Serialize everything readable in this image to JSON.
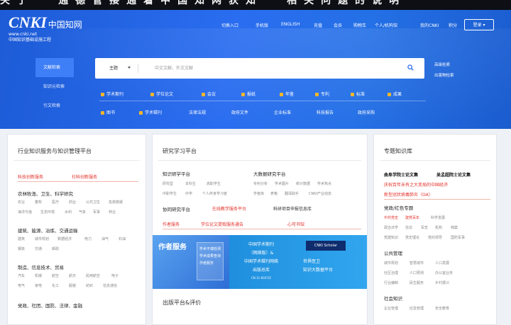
{
  "banner": {
    "text": "关于 “通德管接通着中国知网获知” 相关问题的说明"
  },
  "logo": {
    "mark": "CNKI",
    "mark_cn": "中国知网",
    "url": "www.cnki.net",
    "subtitle": "中国知识基础设施工程"
  },
  "topnav": {
    "items": [
      "切换入口",
      "手机版",
      "ENGLISH",
      "充值",
      "会员",
      "购物车",
      "个人/机构馆",
      "我的CNKI",
      "积分"
    ],
    "login": "登录"
  },
  "search": {
    "tabs": [
      "文献检索",
      "知识元检索",
      "引文检索"
    ],
    "field": "主题",
    "placeholder": "中文文献、外文文献",
    "search_icon": "search-icon",
    "advanced": "高级检索",
    "publication": "出版物检索"
  },
  "databases": {
    "row1": [
      "学术期刊",
      "学位论文",
      "会议",
      "报纸",
      "年鉴",
      "专利",
      "标准",
      "成果"
    ],
    "row2": [
      "图书",
      "学术辑刊",
      "法律法规",
      "政府文件",
      "企业标准",
      "科技报告",
      "政府采购"
    ]
  },
  "industry": {
    "title": "行业知识服务与知识管理平台",
    "top_links": [
      "科技创新服务",
      "社科创新服务"
    ],
    "sections": [
      {
        "heading": "农林牧渔、卫生、科学研究",
        "lines": [
          [
            "农业",
            "畜牧",
            "医疗",
            "药业",
            "公共卫生",
            "急救救援"
          ],
          [
            "海洋与渔",
            "生态环境",
            "水利",
            "气象",
            "军事",
            "林业"
          ]
        ]
      },
      {
        "heading": "建筑、能源、冶炼、交通运输",
        "lines": [
          [
            "建筑",
            "城市规划",
            "数据经济",
            "电力",
            "油气",
            "石油"
          ],
          [
            "钢铁",
            "交通",
            "邮政"
          ]
        ]
      },
      {
        "heading": "制造、信息技术、贸易",
        "lines": [
          [
            "汽车",
            "机械",
            "航空",
            "航天",
            "民用航空",
            "电子"
          ],
          [
            "电气",
            "家电",
            "化工",
            "服装",
            "纺织",
            "信息通信"
          ]
        ]
      },
      {
        "heading": "党政、社团、国防、法律、金融"
      }
    ]
  },
  "research": {
    "title": "研究学习平台",
    "groups": [
      {
        "heading": "知识研学平台",
        "items": [
          [
            "研究型",
            "本科生",
            "高职学生"
          ],
          [
            "中职学生",
            "中学",
            "个人终身学习者"
          ]
        ]
      },
      {
        "heading": "大数据研究平台",
        "items": [
          [
            "专利分析",
            "学术图片",
            "统计数据",
            "学术热点"
          ],
          [
            "学者库",
            "表格",
            "翻译助手",
            "CNKI产业动态"
          ]
        ]
      }
    ],
    "collab": {
      "heading": "协同研究平台",
      "links": [
        "在线教学服务平台",
        "科研项目申报信息库"
      ]
    },
    "author_row": [
      "作者服务",
      "学位论文提取服务通告",
      "心可书馆"
    ],
    "promo": {
      "left_title": "作者服务",
      "left_lines": [
        "学术不端检测",
        "学术成果查询",
        "作者服务"
      ],
      "center_lines": [
        "中国学术期刊",
        "（网络版）&",
        "中国学术辑刊网络",
        "出版总库"
      ],
      "center_small": "CN 11-6037/Z",
      "right_badge": "CNKI Scholar",
      "right_tag": "世界医卫",
      "right_lines": [
        "知识大数据平台"
      ]
    },
    "publishing_title": "出版平台&评价"
  },
  "special": {
    "title": "专题知识库",
    "header_links": [
      "曲阜学院士论文集",
      "吴孟超院士论文集"
    ],
    "red_links": [
      "庆祝百年未有之大变局的中国经济",
      "新型冠状病毒肺炎（OA）"
    ],
    "sections": [
      {
        "heading": "党政/红色专题",
        "lines": [
          [
            "中共党史",
            "建党百年",
            "科学发展"
          ],
          [
            "政治法学",
            "信访",
            "军史",
            "机构",
            "档案"
          ],
          [
            "党建知识",
            "党史理论",
            "党的领导",
            "国防军事"
          ]
        ]
      },
      {
        "heading": "公共管理",
        "lines": [
          [
            "城市规划",
            "智慧城市",
            "人口发展"
          ],
          [
            "社区治理",
            "人口预测",
            "办公室业务"
          ],
          [
            "行业编制",
            "民生服务",
            "乡村振兴"
          ]
        ]
      },
      {
        "heading": "社会知识",
        "lines": [
          [
            "企业管理",
            "应急管理",
            "安全教育"
          ]
        ]
      }
    ]
  },
  "colors": {
    "brand": "#2a6df0",
    "accent": "#f5b72a",
    "link_red": "#e3322b"
  }
}
